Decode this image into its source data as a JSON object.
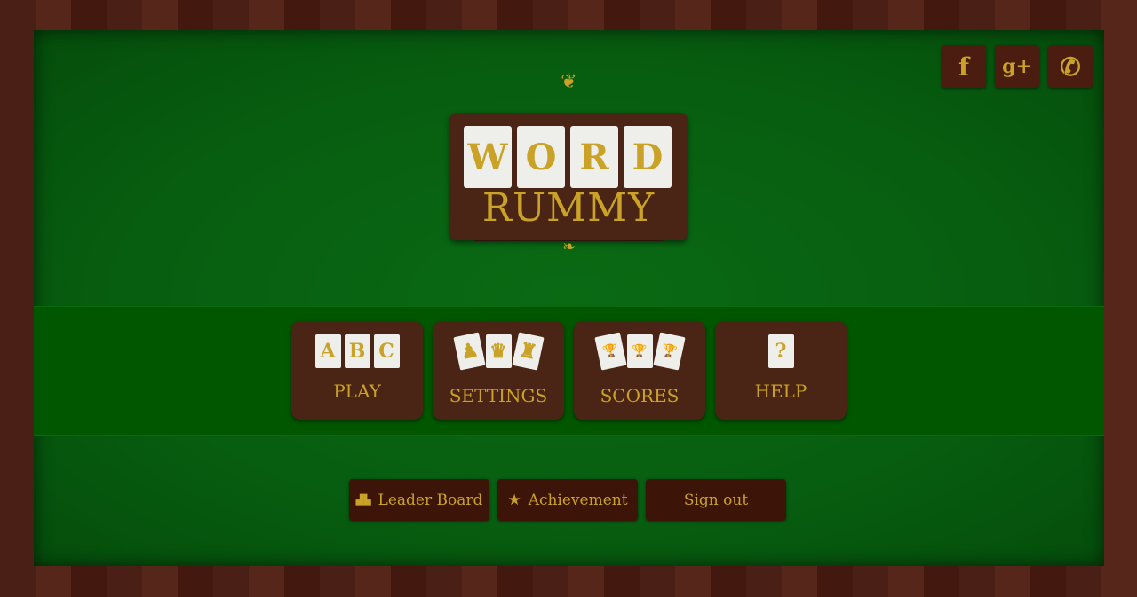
{
  "social": [
    {
      "icon": "facebook-icon",
      "glyph": "f"
    },
    {
      "icon": "google-plus-icon",
      "glyph": "g+"
    },
    {
      "icon": "whatsapp-icon",
      "glyph": "✆"
    }
  ],
  "logo": {
    "tiles": [
      "W",
      "O",
      "R",
      "D"
    ],
    "subtitle": "RUMMY"
  },
  "menu": [
    {
      "label": "PLAY",
      "cards": [
        "A",
        "B",
        "C"
      ]
    },
    {
      "label": "SETTINGS",
      "cards": [
        "♟",
        "♛",
        "♜"
      ]
    },
    {
      "label": "SCORES",
      "cards": [
        "🏆",
        "🏆",
        "🏆"
      ]
    },
    {
      "label": "HELP",
      "cards": [
        "?"
      ]
    }
  ],
  "buttons": [
    {
      "label": "Leader Board",
      "icon": "podium-icon",
      "glyph": "▟▙"
    },
    {
      "label": "Achievement",
      "icon": "star-icon",
      "glyph": "★"
    },
    {
      "label": "Sign out"
    }
  ],
  "colors": {
    "gold": "#c9a227",
    "felt": "#075d10",
    "wood": "#4a2414"
  }
}
